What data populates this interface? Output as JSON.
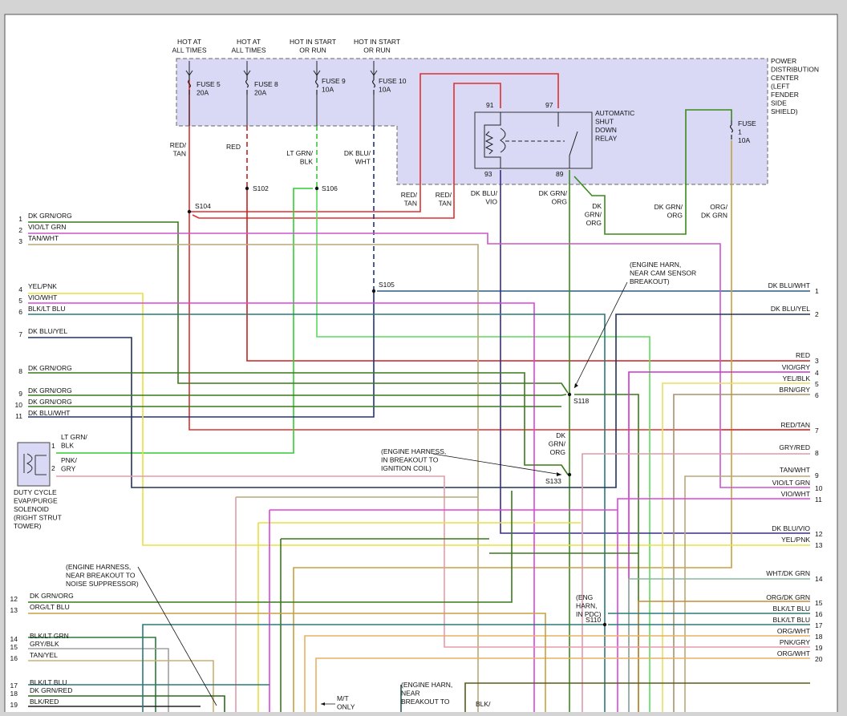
{
  "fuses": {
    "fuse5": {
      "caption": [
        "HOT AT",
        "ALL TIMES"
      ],
      "label": [
        "FUSE 5",
        "20A"
      ]
    },
    "fuse8": {
      "caption": [
        "HOT AT",
        "ALL TIMES"
      ],
      "label": [
        "FUSE 8",
        "20A"
      ]
    },
    "fuse9": {
      "caption": [
        "HOT IN START",
        "OR RUN"
      ],
      "label": [
        "FUSE 9",
        "10A"
      ]
    },
    "fuse10": {
      "caption": [
        "HOT IN START",
        "OR RUN"
      ],
      "label": [
        "FUSE 10",
        "10A"
      ]
    },
    "fuse1": {
      "label": [
        "FUSE",
        "1",
        "10A"
      ]
    }
  },
  "pdc_label": [
    "POWER",
    "DISTRIBUTION",
    "CENTER",
    "(LEFT",
    "FENDER",
    "SIDE",
    "SHIELD)"
  ],
  "relay": {
    "label": [
      "AUTOMATIC",
      "SHUT",
      "DOWN",
      "RELAY"
    ],
    "pins": {
      "p91": "91",
      "p97": "97",
      "p93": "93",
      "p89": "89"
    }
  },
  "wire_colors": {
    "red_tan_a": [
      "RED/",
      "TAN"
    ],
    "red_a": "RED",
    "ltgrn_blk": [
      "LT GRN/",
      "BLK"
    ],
    "dkblu_wht": [
      "DK BLU/",
      "WHT"
    ],
    "red_tan_b": [
      "RED/",
      "TAN"
    ],
    "red_tan_c": [
      "RED/",
      "TAN"
    ],
    "dkblu_vio": [
      "DK BLU/",
      "VIO"
    ],
    "dkgrn_org_a": [
      "DK GRN/",
      "ORG"
    ],
    "dkgrn_org_b": [
      "DK",
      "GRN/",
      "ORG"
    ],
    "dkgrn_org_c": [
      "DK GRN/",
      "ORG"
    ],
    "org_dkgrn": [
      "ORG/",
      "DK GRN"
    ],
    "dkgrn_org_s133": [
      "DK",
      "GRN/",
      "ORG"
    ],
    "blk_bottom": "BLK/"
  },
  "splices": {
    "s104": "S104",
    "s102": "S102",
    "s106": "S106",
    "s105": "S105",
    "s118": "S118",
    "s133": "S133",
    "s110": "S110"
  },
  "notes": {
    "cam": [
      "(ENGINE HARN,",
      "NEAR CAM SENSOR",
      "BREAKOUT)"
    ],
    "coil": [
      "(ENGINE HARNESS,",
      "IN BREAKOUT TO",
      "IGNITION COIL)"
    ],
    "noise": [
      "(ENGINE HARNESS,",
      "NEAR BREAKOUT TO",
      "NOISE SUPPRESSOR)"
    ],
    "pdc": [
      "(ENG",
      "HARN,",
      "IN PDC)"
    ],
    "bottom": [
      "(ENGINE HARN,",
      "NEAR",
      "BREAKOUT TO"
    ],
    "mt": [
      "M/T",
      "ONLY"
    ]
  },
  "solenoid": {
    "label": [
      "DUTY CYCLE",
      "EVAP/PURGE",
      "SOLENOID",
      "(RIGHT STRUT",
      "TOWER)"
    ],
    "pin1": "1",
    "pin2": "2",
    "wire1": [
      "LT GRN/",
      "BLK"
    ],
    "wire2": [
      "PNK/",
      "GRY"
    ]
  },
  "left_connector": [
    {
      "pin": "1",
      "color": "DK GRN/ORG"
    },
    {
      "pin": "2",
      "color": "VIO/LT GRN"
    },
    {
      "pin": "3",
      "color": "TAN/WHT"
    },
    {
      "pin": "4",
      "color": "YEL/PNK"
    },
    {
      "pin": "5",
      "color": "VIO/WHT"
    },
    {
      "pin": "6",
      "color": "BLK/LT BLU"
    },
    {
      "pin": "7",
      "color": "DK BLU/YEL"
    },
    {
      "pin": "8",
      "color": "DK GRN/ORG"
    },
    {
      "pin": "9",
      "color": "DK GRN/ORG"
    },
    {
      "pin": "10",
      "color": "DK GRN/ORG"
    },
    {
      "pin": "11",
      "color": "DK BLU/WHT"
    }
  ],
  "left_connector_lower": [
    {
      "pin": "12",
      "color": "DK GRN/ORG"
    },
    {
      "pin": "13",
      "color": "ORG/LT BLU"
    },
    {
      "pin": "14",
      "color": "BLK/LT GRN"
    },
    {
      "pin": "15",
      "color": "GRY/BLK"
    },
    {
      "pin": "16",
      "color": "TAN/YEL"
    },
    {
      "pin": "17",
      "color": "BLK/LT BLU"
    },
    {
      "pin": "18",
      "color": "DK GRN/RED"
    },
    {
      "pin": "19",
      "color": "BLK/RED"
    }
  ],
  "right_connector": [
    {
      "pin": "1",
      "color": "DK BLU/WHT"
    },
    {
      "pin": "2",
      "color": "DK BLU/YEL"
    },
    {
      "pin": "3",
      "color": "RED"
    },
    {
      "pin": "4",
      "color": "VIO/GRY"
    },
    {
      "pin": "5",
      "color": "YEL/BLK"
    },
    {
      "pin": "6",
      "color": "BRN/GRY"
    },
    {
      "pin": "7",
      "color": "RED/TAN"
    },
    {
      "pin": "8",
      "color": "GRY/RED"
    },
    {
      "pin": "9",
      "color": "TAN/WHT"
    },
    {
      "pin": "10",
      "color": "VIO/LT GRN"
    },
    {
      "pin": "11",
      "color": "VIO/WHT"
    },
    {
      "pin": "12",
      "color": "DK BLU/VIO"
    },
    {
      "pin": "13",
      "color": "YEL/PNK"
    },
    {
      "pin": "14",
      "color": "WHT/DK GRN"
    },
    {
      "pin": "15",
      "color": "ORG/DK GRN"
    },
    {
      "pin": "16",
      "color": "BLK/LT BLU"
    },
    {
      "pin": "17",
      "color": "BLK/LT BLU"
    },
    {
      "pin": "18",
      "color": "ORG/WHT"
    },
    {
      "pin": "19",
      "color": "PNK/GRY"
    },
    {
      "pin": "20",
      "color": "ORG/WHT"
    }
  ]
}
